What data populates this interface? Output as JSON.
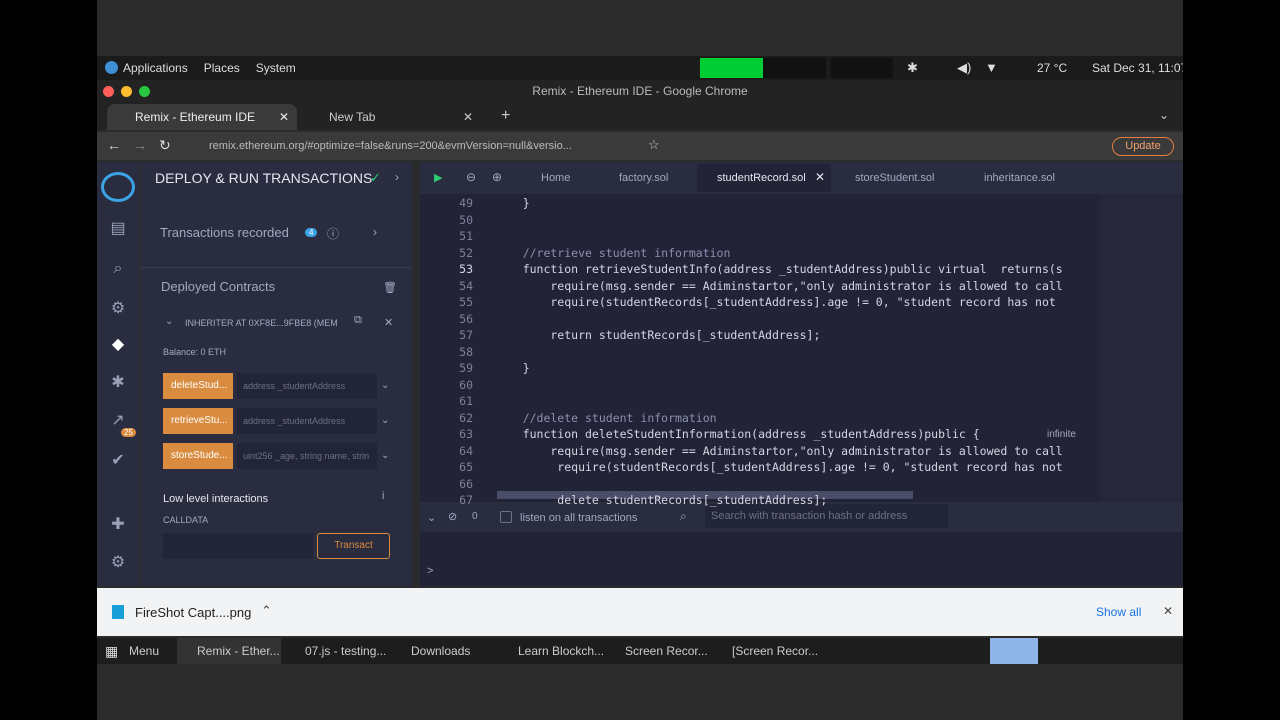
{
  "os_bar": {
    "applications": "Applications",
    "places": "Places",
    "system": "System",
    "temperature": "27 °C",
    "clock": "Sat Dec 31, 11:07"
  },
  "window_title": "Remix - Ethereum IDE - Google Chrome",
  "browser_tabs": [
    {
      "label": "Remix - Ethereum IDE"
    },
    {
      "label": "New Tab"
    }
  ],
  "address_bar": {
    "url": "remix.ethereum.org/#optimize=false&runs=200&evmVersion=null&versio..."
  },
  "update_button": "Update",
  "remix": {
    "panel_title": "DEPLOY & RUN TRANSACTIONS",
    "transactions_recorded": "Transactions recorded",
    "transactions_count": "4",
    "deployed_contracts": "Deployed Contracts",
    "instance": "INHERITER AT 0XF8E...9FBE8 (MEM",
    "balance": "Balance: 0 ETH",
    "functions": [
      {
        "label": "deleteStud...",
        "placeholder": "address _studentAddress"
      },
      {
        "label": "retrieveStu...",
        "placeholder": "address _studentAddress"
      },
      {
        "label": "storeStude...",
        "placeholder": "uint256 _age, string name, strin"
      }
    ],
    "low_level": "Low level interactions",
    "calldata": "CALLDATA",
    "transact": "Transact",
    "plugin_badge": "25"
  },
  "editor_tabs": [
    {
      "label": "Home"
    },
    {
      "label": "factory.sol"
    },
    {
      "label": "studentRecord.sol"
    },
    {
      "label": "storeStudent.sol"
    },
    {
      "label": "inheritance.sol"
    }
  ],
  "code_lines": [
    {
      "n": "49",
      "t": "    }"
    },
    {
      "n": "50",
      "t": ""
    },
    {
      "n": "51",
      "t": ""
    },
    {
      "n": "52",
      "t": "    //retrieve student information"
    },
    {
      "n": "53",
      "t": "    function retrieveStudentInfo(address _studentAddress)public virtual  returns(s"
    },
    {
      "n": "54",
      "t": "        require(msg.sender == Adiminstartor,\"only administrator is allowed to call"
    },
    {
      "n": "55",
      "t": "        require(studentRecords[_studentAddress].age != 0, \"student record has not"
    },
    {
      "n": "56",
      "t": ""
    },
    {
      "n": "57",
      "t": "        return studentRecords[_studentAddress];"
    },
    {
      "n": "58",
      "t": ""
    },
    {
      "n": "59",
      "t": "    }"
    },
    {
      "n": "60",
      "t": ""
    },
    {
      "n": "61",
      "t": ""
    },
    {
      "n": "62",
      "t": "    //delete student information"
    },
    {
      "n": "63",
      "t": "    function deleteStudentInformation(address _studentAddress)public {"
    },
    {
      "n": "64",
      "t": "        require(msg.sender == Adiminstartor,\"only administrator is allowed to call"
    },
    {
      "n": "65",
      "t": "         require(studentRecords[_studentAddress].age != 0, \"student record has not"
    },
    {
      "n": "66",
      "t": ""
    },
    {
      "n": "67",
      "t": "         delete studentRecords[_studentAddress];"
    }
  ],
  "gas_hint": "infinite",
  "terminal": {
    "count": "0",
    "listen_label": "listen on all transactions",
    "search_placeholder": "Search with transaction hash or address",
    "prompt": ">"
  },
  "downloads": {
    "file": "FireShot Capt....png",
    "show_all": "Show all"
  },
  "taskbar": {
    "menu": "Menu",
    "items": [
      "Remix - Ether...",
      "07.js - testing...",
      "Downloads",
      "Learn Blockch...",
      "Screen Recor...",
      "[Screen Recor..."
    ]
  }
}
